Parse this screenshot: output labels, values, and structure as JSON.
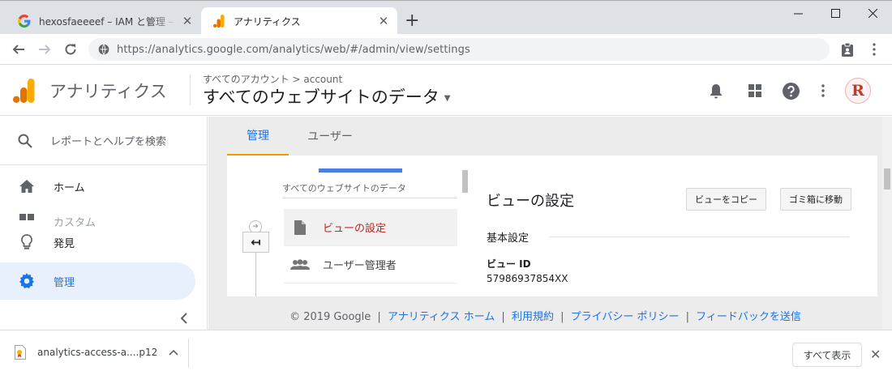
{
  "browser": {
    "tabs": [
      {
        "title": "hexosfaeeeef – IAM と管理 – analytics",
        "favicon": "google-g-icon"
      },
      {
        "title": "アナリティクス",
        "favicon": "analytics-icon"
      }
    ],
    "url": "https://analytics.google.com/analytics/web/#/admin/view/settings"
  },
  "header": {
    "app_name": "アナリティクス",
    "breadcrumb": "すべてのアカウント > account",
    "view_title": "すべてのウェブサイトのデータ",
    "avatar_letter": "R"
  },
  "leftnav": {
    "search_placeholder": "レポートとヘルプを検索",
    "items": [
      {
        "label": "ホーム",
        "icon": "home-icon"
      },
      {
        "label": "カスタム",
        "icon": "grid-icon"
      },
      {
        "label": "発見",
        "icon": "lightbulb-icon"
      },
      {
        "label": "管理",
        "icon": "gear-icon"
      }
    ]
  },
  "main": {
    "tabs": [
      {
        "label": "管理"
      },
      {
        "label": "ユーザー"
      }
    ],
    "column_header": "すべてのウェブサイトのデータ",
    "column_items": [
      {
        "label": "ビューの設定",
        "icon": "document-icon"
      },
      {
        "label": "ユーザー管理者",
        "icon": "people-icon"
      }
    ],
    "settings_title": "ビューの設定",
    "copy_view_button": "ビューをコピー",
    "trash_button": "ゴミ箱に移動",
    "section_label": "基本設定",
    "view_id_label": "ビュー ID",
    "view_id_value": "57986937854XX"
  },
  "footer": {
    "copyright": "© 2019 Google",
    "links": [
      "アナリティクス ホーム",
      "利用規約",
      "プライバシー ポリシー",
      "フィードバックを送信"
    ],
    "separator": "|"
  },
  "downloads": {
    "filename": "analytics-access-a....p12",
    "show_all": "すべて表示"
  },
  "colors": {
    "accent_blue": "#1a73e8",
    "active_red": "#c5221f",
    "tab_underline": "#f29900",
    "logo_orange": "#f9ab00",
    "logo_dark_orange": "#e37400"
  }
}
